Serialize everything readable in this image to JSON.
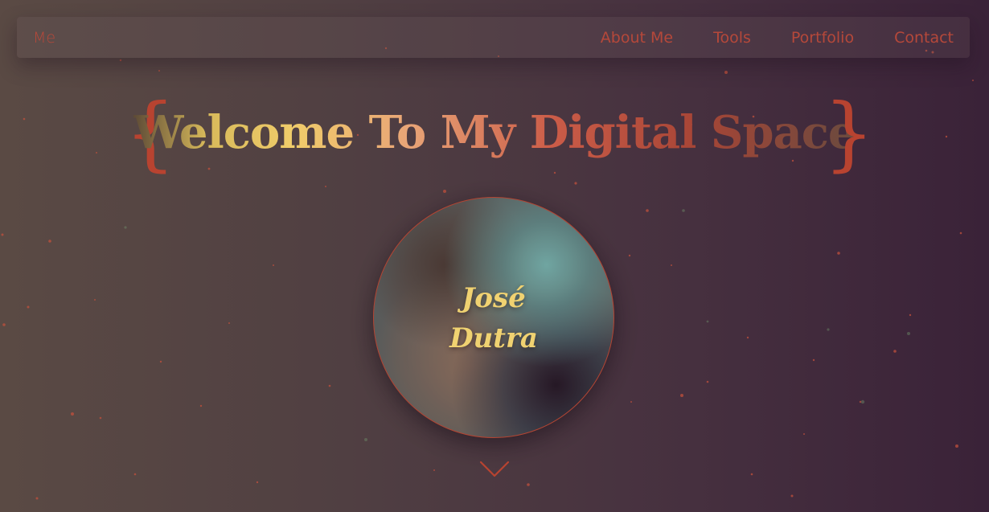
{
  "navbar": {
    "brand": "Me",
    "links": [
      "About Me",
      "Tools",
      "Portfolio",
      "Contact"
    ]
  },
  "hero": {
    "brace_left": "{",
    "brace_right": "}",
    "title": "Welcome To My Digital Space"
  },
  "profile": {
    "first_name": "José",
    "last_name": "Dutra"
  },
  "icons": {
    "scroll": "chevron-down-icon"
  },
  "colors": {
    "accent": "#b84330",
    "name": "#f2d26c",
    "background_left": "#5a4a44",
    "background_right": "#3a2238"
  }
}
